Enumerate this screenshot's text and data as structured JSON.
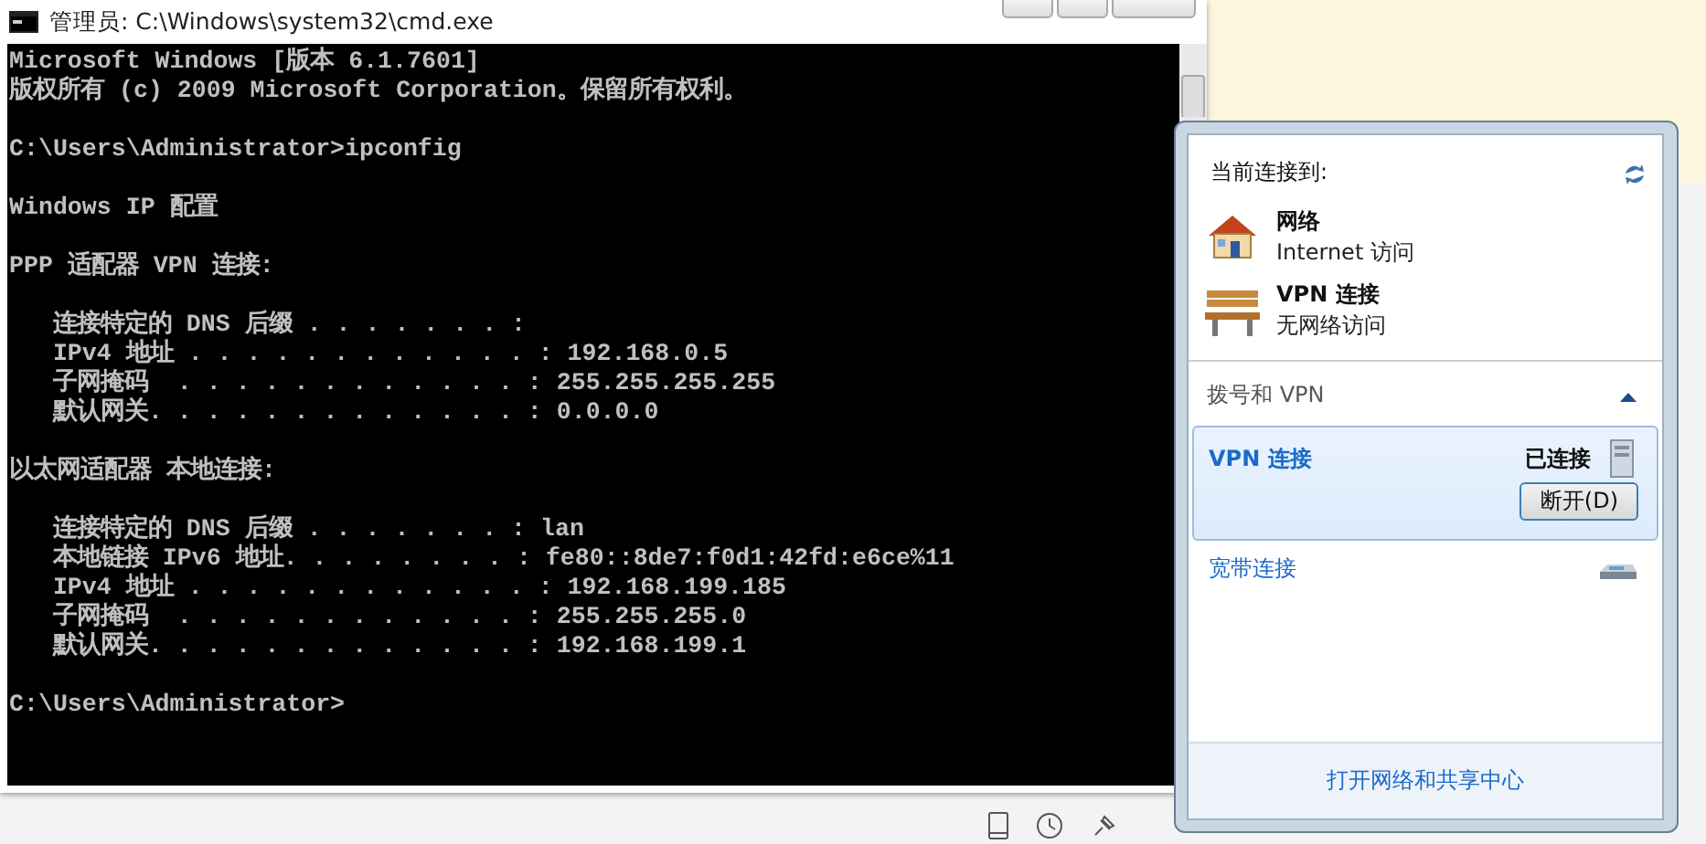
{
  "console_window": {
    "title": "管理员: C:\\Windows\\system32\\cmd.exe",
    "blocks": [
      [
        "Microsoft Windows [版本 6.1.7601]",
        "版权所有 (c) 2009 Microsoft Corporation。保留所有权利。"
      ],
      [
        "C:\\Users\\Administrator>ipconfig"
      ],
      [
        "Windows IP 配置"
      ],
      [
        "PPP 适配器 VPN 连接:"
      ],
      [
        "   连接特定的 DNS 后缀 . . . . . . . :",
        "   IPv4 地址 . . . . . . . . . . . . : 192.168.0.5",
        "   子网掩码  . . . . . . . . . . . . : 255.255.255.255",
        "   默认网关. . . . . . . . . . . . . : 0.0.0.0"
      ],
      [
        "以太网适配器 本地连接:"
      ],
      [
        "   连接特定的 DNS 后缀 . . . . . . . : lan",
        "   本地链接 IPv6 地址. . . . . . . . : fe80::8de7:f0d1:42fd:e6ce%11",
        "   IPv4 地址 . . . . . . . . . . . . : 192.168.199.185",
        "   子网掩码  . . . . . . . . . . . . : 255.255.255.0",
        "   默认网关. . . . . . . . . . . . . : 192.168.199.1"
      ],
      [
        "C:\\Users\\Administrator>"
      ]
    ]
  },
  "network_flyout": {
    "header": "当前连接到:",
    "connections": [
      {
        "kind": "house",
        "name": "网络",
        "status": "Internet 访问"
      },
      {
        "kind": "bench",
        "name": "VPN 连接",
        "status": "无网络访问"
      }
    ],
    "section": {
      "title": "拨号和 VPN",
      "expanded": true
    },
    "dialups": [
      {
        "kind": "vpn",
        "name": "VPN 连接",
        "selected": true,
        "state": "已连接",
        "action": "断开(D)"
      },
      {
        "kind": "modem",
        "name": "宽带连接",
        "selected": false
      }
    ],
    "footer_link": "打开网络和共享中心"
  }
}
